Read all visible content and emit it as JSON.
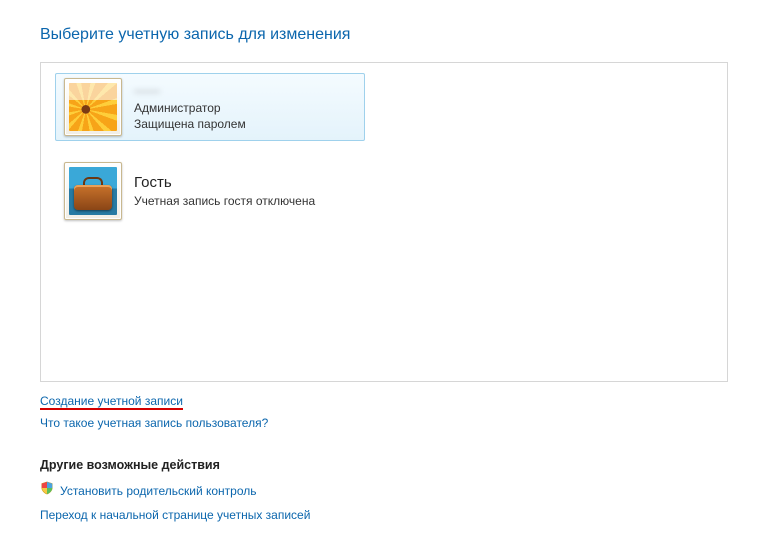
{
  "title": "Выберите учетную запись для изменения",
  "accounts": [
    {
      "name": "——",
      "role": "Администратор",
      "status": "Защищена паролем",
      "selected": true,
      "avatar": "flower"
    },
    {
      "name": "Гость",
      "role": "Учетная запись гостя отключена",
      "status": "",
      "selected": false,
      "avatar": "suitcase"
    }
  ],
  "links": {
    "create_account": "Создание учетной записи",
    "what_is_account": "Что такое учетная запись пользователя?"
  },
  "other_actions": {
    "heading": "Другие возможные действия",
    "parental_controls": "Установить родительский контроль",
    "go_home": "Переход к начальной странице учетных записей"
  }
}
